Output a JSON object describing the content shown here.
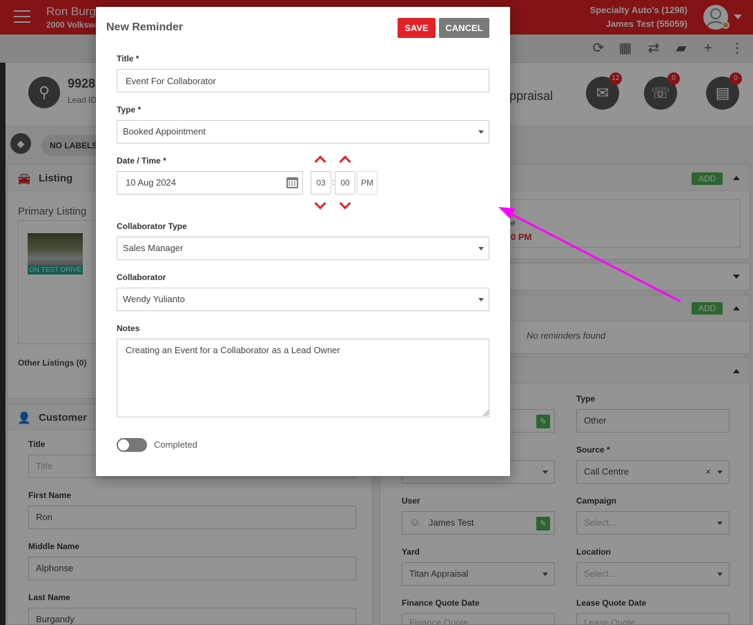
{
  "topbar": {
    "lead_name": "Ron Burgundy",
    "lead_vehicle": "2000 Volkswagen",
    "dealer": "Specialty Auto's (1298)",
    "user": "James Test (55059)"
  },
  "lead": {
    "number": "9928",
    "lead_id_label": "Lead ID",
    "appraisal_text": "ppraisal",
    "email_count": "12",
    "call_count": "0",
    "chat_count": "0"
  },
  "labels_chip": "NO LABELS",
  "listing_panel": {
    "title": "Listing",
    "primary": "Primary Listing",
    "thumb_badge": "ON TEST DRIVE",
    "other": "Other Listings (0)"
  },
  "right_panels": {
    "add_label": "ADD",
    "appt_fragment_1": "e",
    "appt_fragment_2": "0 PM",
    "no_reminders": "No reminders found"
  },
  "customer_panel": {
    "title": "Customer",
    "fields": [
      {
        "label": "Title",
        "value": "",
        "placeholder": "Title"
      },
      {
        "label": "First Name",
        "value": "Ron"
      },
      {
        "label": "Middle Name",
        "value": "Alphonse"
      },
      {
        "label": "Last Name",
        "value": "Burgandy"
      }
    ]
  },
  "details_panel": {
    "type_label": "Type",
    "type_value": "Other",
    "source_label": "Source *",
    "source_value": "Call Centre",
    "user_label": "User",
    "user_value": "James Test",
    "campaign_label": "Campaign",
    "campaign_placeholder": "Select...",
    "yard_label": "Yard",
    "yard_value": "Titan Appraisal",
    "location_label": "Location",
    "location_placeholder": "Select...",
    "finance_label": "Finance Quote Date",
    "finance_placeholder": "Finance Quote",
    "lease_label": "Lease Quote Date",
    "lease_placeholder": "Lease Quote"
  },
  "modal": {
    "title": "New Reminder",
    "save_label": "SAVE",
    "cancel_label": "CANCEL",
    "title_label": "Title *",
    "title_value": "Event For Collaborator",
    "type_label": "Type *",
    "type_value": "Booked Appointment",
    "datetime_label": "Date / Time *",
    "date_value": "10 Aug 2024",
    "hour": "03",
    "minute": "00",
    "meridian": "PM",
    "collab_type_label": "Collaborator Type",
    "collab_type_value": "Sales Manager",
    "collab_label": "Collaborator",
    "collab_value": "Wendy Yulianto",
    "notes_label": "Notes",
    "notes_value": "Creating an Event for a Collaborator as a Lead Owner",
    "completed_label": "Completed"
  },
  "colors": {
    "brand_red": "#e32227",
    "add_green": "#4caf50",
    "arrow_magenta": "#ff00ff"
  }
}
